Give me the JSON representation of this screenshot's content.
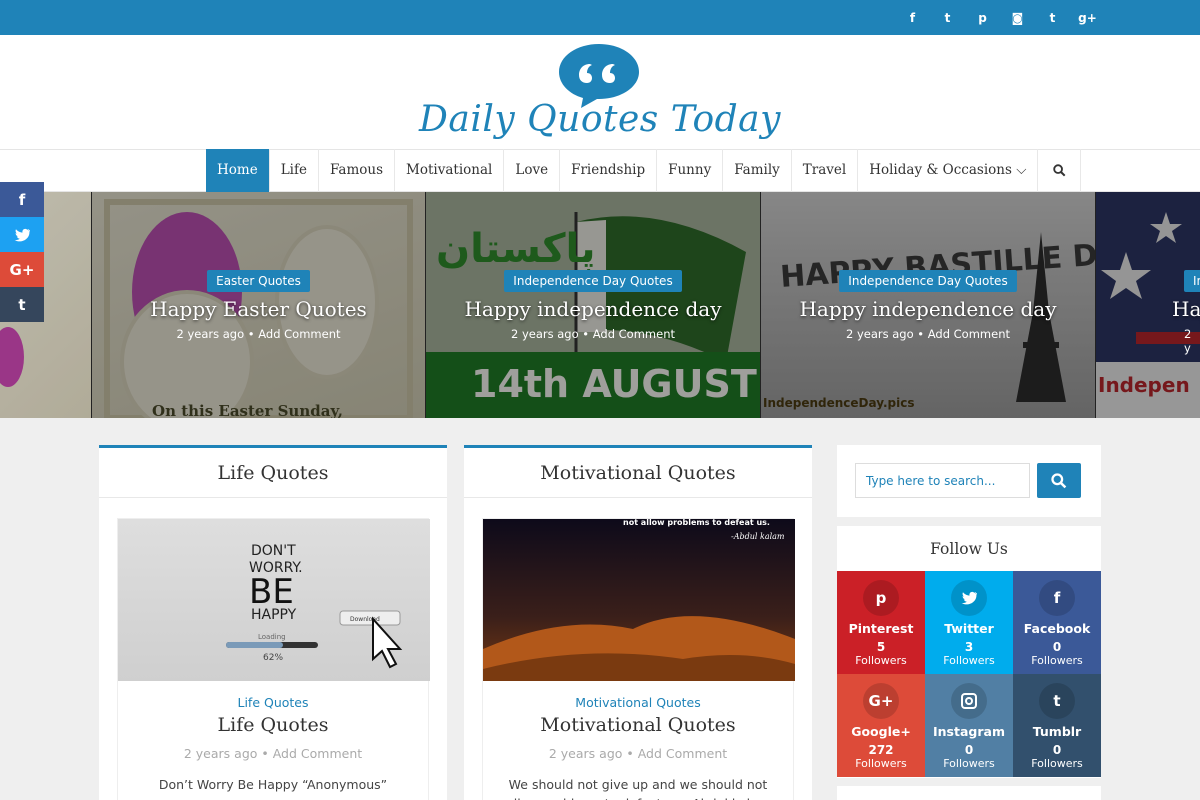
{
  "site": {
    "name": "Daily Quotes Today",
    "brand_color": "#1f83b8"
  },
  "topbar_social": [
    {
      "icon": "facebook-icon",
      "glyph": "f"
    },
    {
      "icon": "twitter-icon",
      "glyph": "t"
    },
    {
      "icon": "pinterest-icon",
      "glyph": "p"
    },
    {
      "icon": "instagram-icon",
      "glyph": "◙"
    },
    {
      "icon": "tumblr-icon",
      "glyph": "t"
    },
    {
      "icon": "google-plus-icon",
      "glyph": "g+"
    }
  ],
  "nav": {
    "items": [
      "Home",
      "Life",
      "Famous",
      "Motivational",
      "Love",
      "Friendship",
      "Funny",
      "Family",
      "Travel",
      "Holiday & Occasions ⌵"
    ],
    "active": "Home"
  },
  "share_bar": [
    {
      "icon": "facebook-icon",
      "glyph": "f",
      "color": "#3b5998"
    },
    {
      "icon": "twitter-icon",
      "glyph": "🐦",
      "color": "#1da1f2"
    },
    {
      "icon": "google-plus-icon",
      "glyph": "G+",
      "color": "#dd4b39"
    },
    {
      "icon": "tumblr-icon",
      "glyph": "t",
      "color": "#35465c"
    }
  ],
  "slider": [
    {
      "category": "",
      "title": "",
      "meta": ""
    },
    {
      "category": "Easter Quotes",
      "title": "Happy Easter Quotes",
      "meta": "2 years ago • Add Comment"
    },
    {
      "category": "Independence Day Quotes",
      "title": "Happy independence day",
      "meta": "2 years ago • Add Comment"
    },
    {
      "category": "Independence Day Quotes",
      "title": "Happy independence day",
      "meta": "2 years ago • Add Comment"
    },
    {
      "category": "In",
      "title": "Happ",
      "meta": "2 y"
    }
  ],
  "slider_image_text": {
    "easter": "On this Easter Sunday,",
    "pakistan_date": "14th AUGUST",
    "pakistan_script": "پاکستان",
    "bastille": "HAPPY BASTILLE DAY",
    "bastille_site": "IndependenceDay.pics",
    "usa": "Indepen"
  },
  "cards": [
    {
      "header": "Life Quotes",
      "category": "Life Quotes",
      "title": "Life Quotes",
      "meta": "2 years ago • Add Comment",
      "excerpt": "Don’t Worry Be Happy “Anonymous”",
      "thumb": {
        "line1": "DON'T",
        "line2": "WORRY.",
        "line3": "BE",
        "line4": "HAPPY",
        "loading": "Loading",
        "progress_label": "62%",
        "progress": 0.62,
        "button": "Download"
      }
    },
    {
      "header": "Motivational Quotes",
      "category": "Motivational Quotes",
      "title": "Motivational Quotes",
      "meta": "2 years ago • Add Comment",
      "excerpt": "We should not give up and we should not allow problems to defeat us. -Abdul kalam",
      "thumb": {
        "quote": "not allow problems to defeat us.",
        "author": "-Abdul kalam"
      }
    }
  ],
  "sidebar": {
    "search_placeholder": "Type here to search...",
    "follow_title": "Follow Us",
    "follow": [
      {
        "name": "Pinterest",
        "count": "5",
        "label": "Followers",
        "glyph": "p",
        "icon": "pinterest-icon",
        "color": "#cb2027"
      },
      {
        "name": "Twitter",
        "count": "3",
        "label": "Followers",
        "glyph": "🐦",
        "icon": "twitter-icon",
        "color": "#00aced"
      },
      {
        "name": "Facebook",
        "count": "0",
        "label": "Followers",
        "glyph": "f",
        "icon": "facebook-icon",
        "color": "#3b5998"
      },
      {
        "name": "Google+",
        "count": "272",
        "label": "Followers",
        "glyph": "G+",
        "icon": "google-plus-icon",
        "color": "#dd4b39"
      },
      {
        "name": "Instagram",
        "count": "0",
        "label": "Followers",
        "glyph": "◙",
        "icon": "instagram-icon",
        "color": "#517fa4"
      },
      {
        "name": "Tumblr",
        "count": "0",
        "label": "Followers",
        "glyph": "t",
        "icon": "tumblr-icon",
        "color": "#32506d"
      }
    ]
  }
}
